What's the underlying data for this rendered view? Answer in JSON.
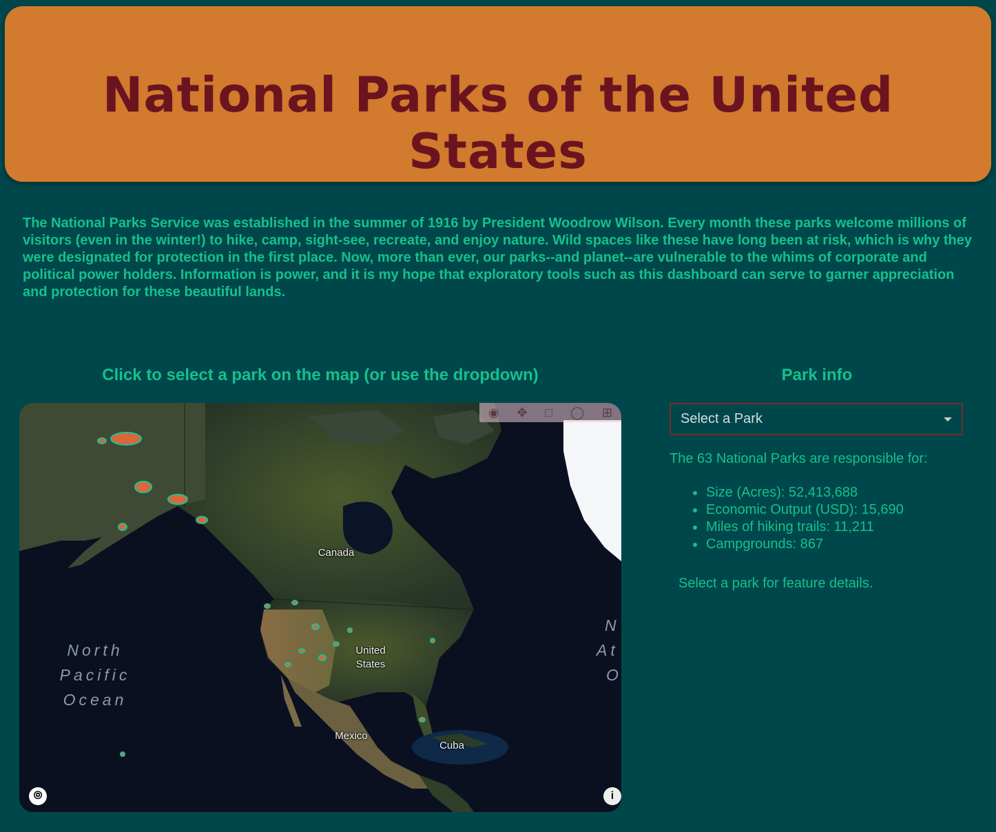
{
  "header": {
    "title": "National Parks of the United States"
  },
  "intro": {
    "text": "The National Parks Service was established in the summer of 1916 by President Woodrow Wilson. Every month these parks welcome millions of visitors (even in the winter!) to hike, camp, sight-see, recreate, and enjoy nature. Wild spaces like these have long been at risk, which is why they were designated for protection in the first place. Now, more than ever, our parks--and planet--are vulnerable to the whims of corporate and political power holders. Information is power, and it is my hope that exploratory tools such as this dashboard can serve to garner appreciation and protection for these beautiful lands."
  },
  "map": {
    "heading": "Click to select a park on the map (or use the dropdown)",
    "labels": {
      "canada": "Canada",
      "us_line1": "United",
      "us_line2": "States",
      "mexico": "Mexico",
      "cuba": "Cuba",
      "pacific_line1": "North",
      "pacific_line2": "Pacific",
      "pacific_line3": "Ocean",
      "atlantic_line1": "N",
      "atlantic_line2": "At",
      "atlantic_line3": "O"
    },
    "toolbar": [
      "camera-icon",
      "pan-icon",
      "box-select-icon",
      "lasso-icon",
      "zoom-in-icon"
    ],
    "bottom_left_icon": "mapbox-logo-icon",
    "bottom_right_icon": "info-icon"
  },
  "info": {
    "heading": "Park info",
    "dropdown": {
      "placeholder": "Select a Park"
    },
    "summary": "The 63 National Parks are responsible for:",
    "stats": [
      "Size (Acres): 52,413,688",
      "Economic Output (USD): 15,690",
      "Miles of hiking trails: 11,211",
      "Campgrounds: 867"
    ],
    "hint": "Select a park for feature details."
  },
  "colors": {
    "background": "#00474b",
    "banner": "#d27a2d",
    "title": "#6b1420",
    "accent_text": "#14c18c",
    "dropdown_border": "#7a2a2a"
  }
}
